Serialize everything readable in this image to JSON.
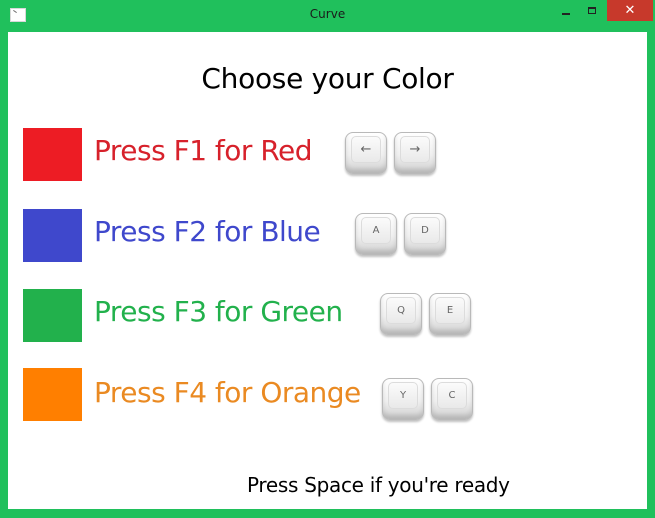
{
  "window": {
    "title": "Curve",
    "close_glyph": "✕"
  },
  "heading": "Choose your Color",
  "options": [
    {
      "label": "Press F1 for Red",
      "color": "#ed1c24",
      "text_color": "#d7212b",
      "keys": [
        "←",
        "→"
      ]
    },
    {
      "label": "Press F2 for Blue",
      "color": "#3f48cc",
      "text_color": "#3f48cc",
      "keys": [
        "A",
        "D"
      ]
    },
    {
      "label": "Press F3 for Green",
      "color": "#22b14c",
      "text_color": "#22b14c",
      "keys": [
        "Q",
        "E"
      ]
    },
    {
      "label": "Press F4 for Orange",
      "color": "#ff7f00",
      "text_color": "#ea8a22",
      "keys": [
        "Y",
        "C"
      ]
    }
  ],
  "footer": "Press Space if you're ready"
}
